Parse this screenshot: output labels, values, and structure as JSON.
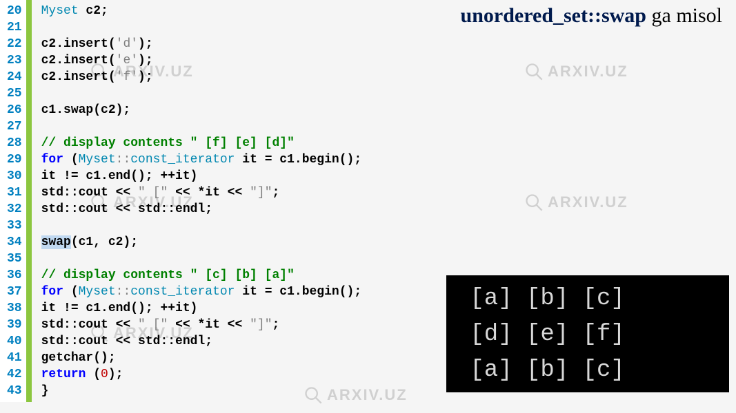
{
  "title": {
    "bold": "unordered_set::swap",
    "rest": " ga misol"
  },
  "watermark_text": "ARXIV.UZ",
  "gutter": [
    "20",
    "21",
    "22",
    "23",
    "24",
    "25",
    "26",
    "27",
    "28",
    "29",
    "30",
    "31",
    "32",
    "33",
    "34",
    "35",
    "36",
    "37",
    "38",
    "39",
    "40",
    "41",
    "42",
    "43"
  ],
  "code": {
    "l20": {
      "a": "Myset",
      "b": " c2;"
    },
    "l22": {
      "a": "c2.insert(",
      "b": "'d'",
      "c": ");"
    },
    "l23": {
      "a": "c2.insert(",
      "b": "'e'",
      "c": ");"
    },
    "l24": {
      "a": "c2.insert(",
      "b": "'f'",
      "c": ");"
    },
    "l26": "c1.swap(c2);",
    "l28": "// display contents \" [f] [e] [d]\"",
    "l29": {
      "a": "for",
      "b": " (",
      "c": "Myset",
      "d": "::",
      "e": "const_iterator",
      "f": " it = c1.begin();"
    },
    "l30": "it != c1.end(); ++it)",
    "l31": {
      "a": "std::cout << ",
      "b": "\" [\"",
      "c": " << *it << ",
      "d": "\"]\"",
      "e": ";"
    },
    "l32": "std::cout << std::endl;",
    "l34": {
      "a": "swap",
      "b": "(c1, c2);"
    },
    "l36": "// display contents \" [c] [b] [a]\"",
    "l37": {
      "a": "for",
      "b": " (",
      "c": "Myset",
      "d": "::",
      "e": "const_iterator",
      "f": " it = c1.begin();"
    },
    "l38": "it != c1.end(); ++it)",
    "l39": {
      "a": "std::cout << ",
      "b": "\" [\"",
      "c": " << *it << ",
      "d": "\"]\"",
      "e": ";"
    },
    "l40": "std::cout << std::endl;",
    "l41": "getchar();",
    "l42": {
      "a": "return",
      "b": " (",
      "c": "0",
      "d": ");"
    },
    "l43": "}"
  },
  "console": {
    "r1": " [a] [b] [c]",
    "r2": " [d] [e] [f]",
    "r3": " [a] [b] [c]"
  }
}
